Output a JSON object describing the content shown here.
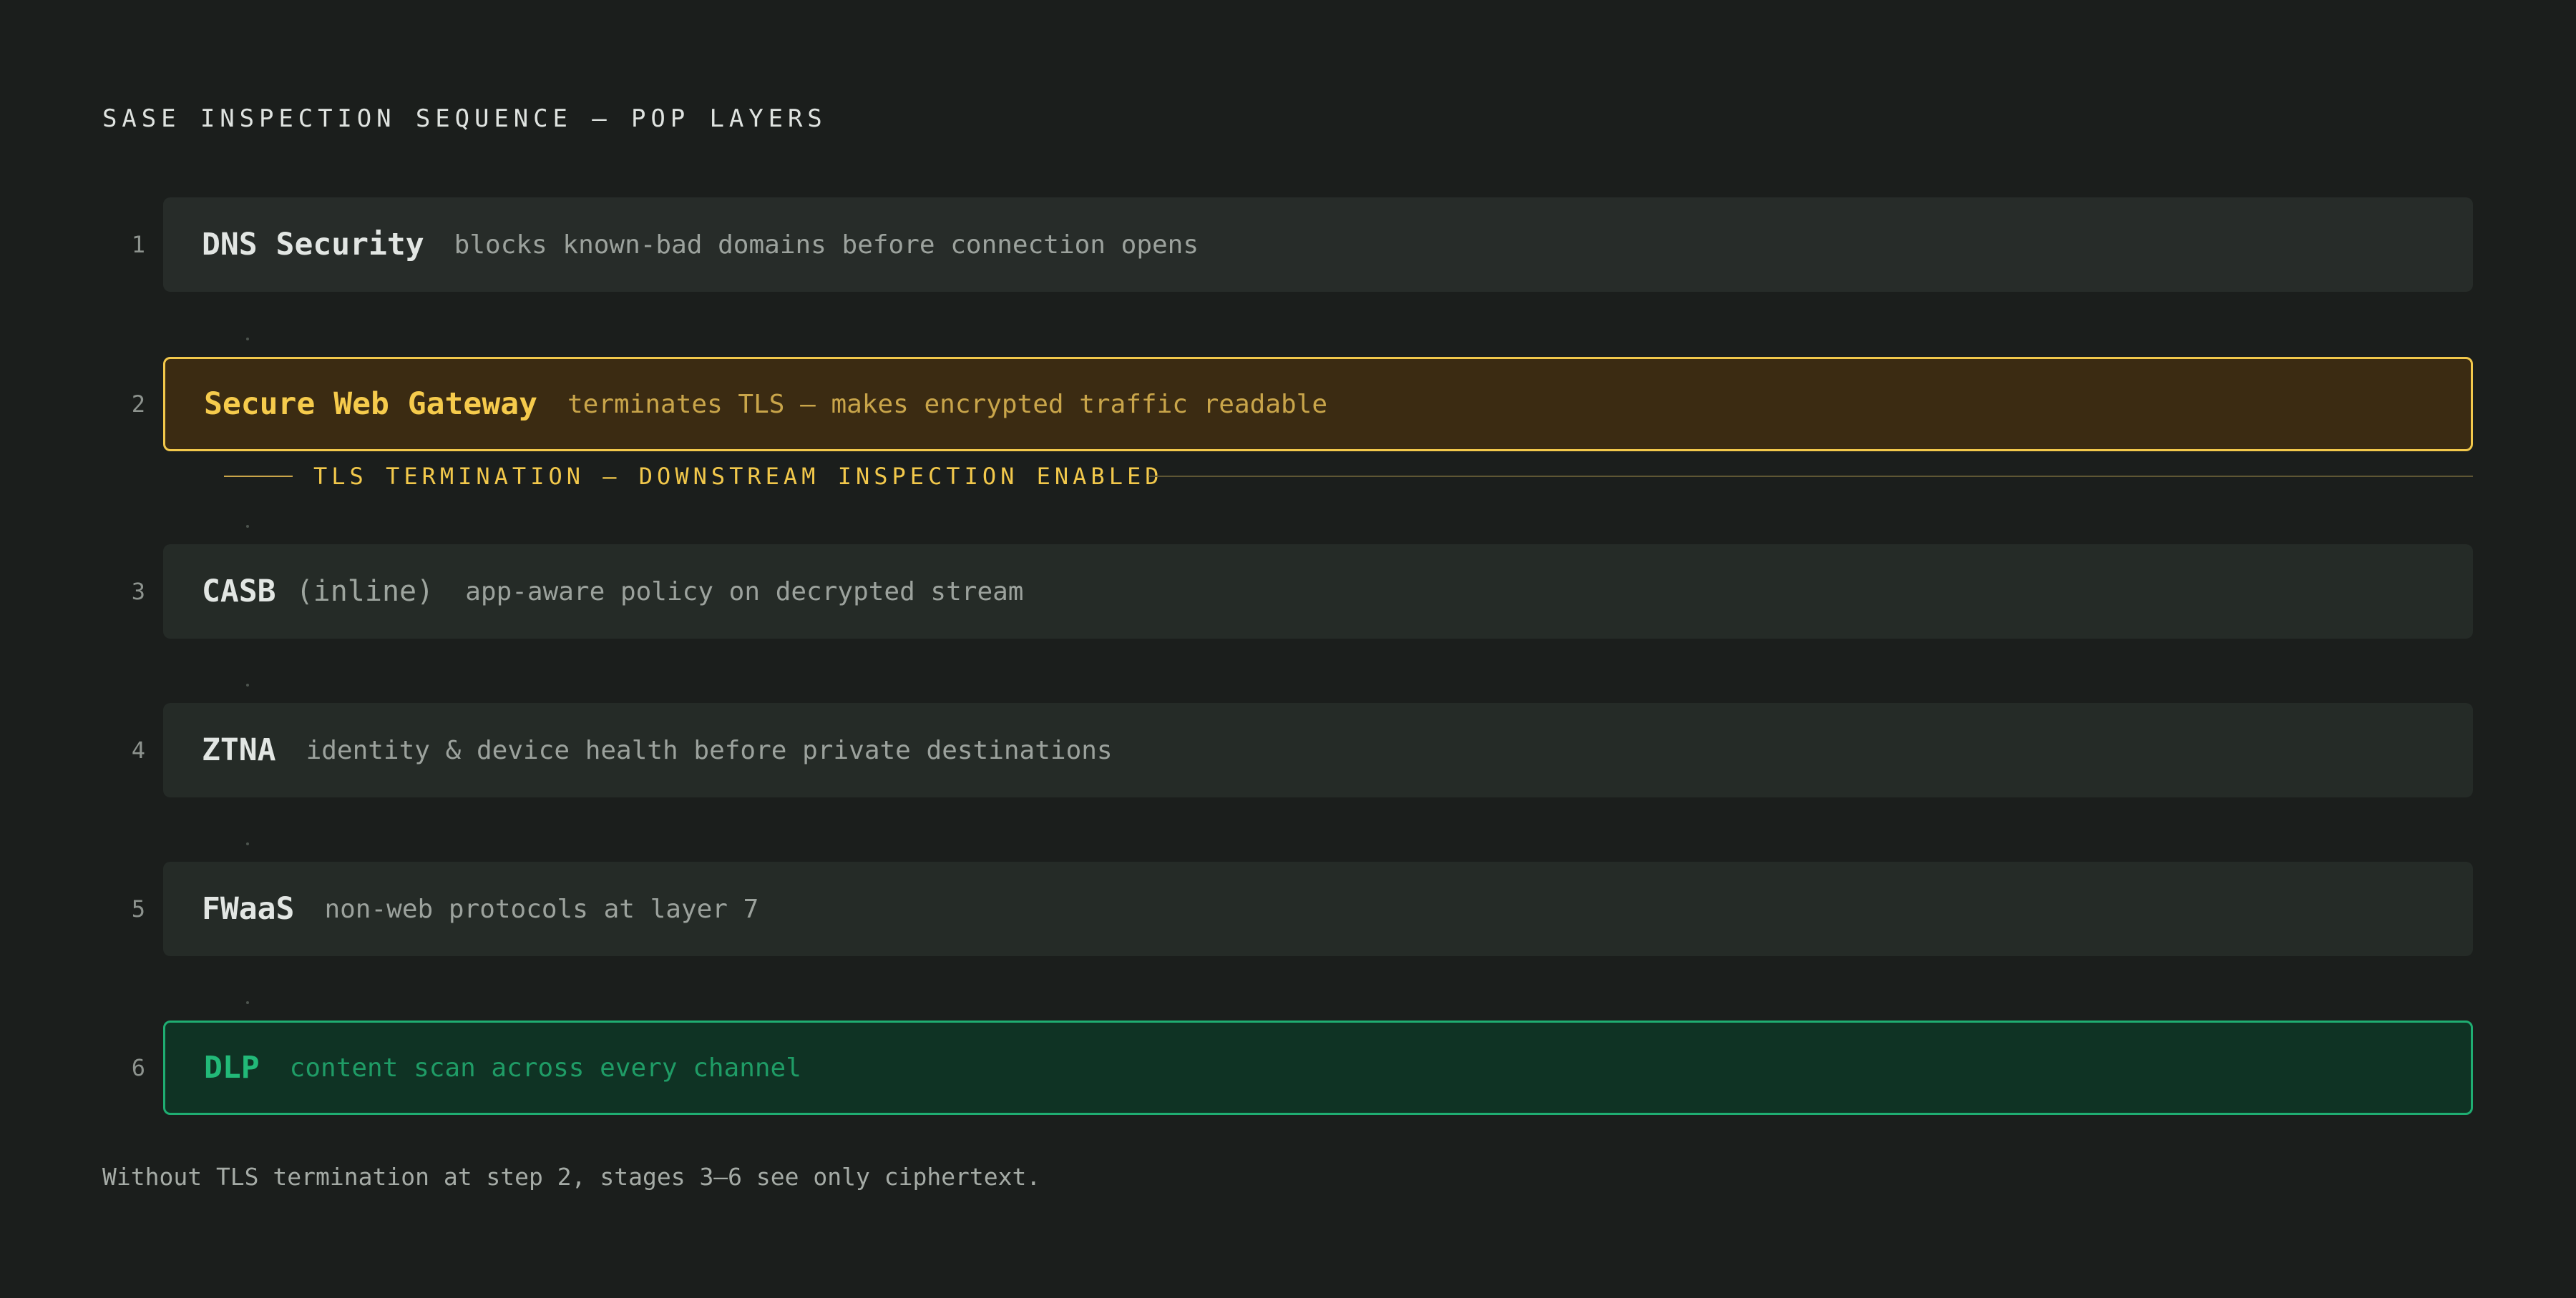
{
  "title": "SASE INSPECTION SEQUENCE — POP LAYERS",
  "steps": [
    {
      "number": "1",
      "name": "DNS Security",
      "tag": "",
      "description": "blocks known-bad domains before connection opens"
    },
    {
      "number": "2",
      "name": "Secure Web Gateway",
      "tag": "",
      "description": "terminates TLS — makes encrypted traffic readable"
    },
    {
      "number": "3",
      "name": "CASB",
      "tag": "(inline)",
      "description": "app-aware policy on decrypted stream"
    },
    {
      "number": "4",
      "name": "ZTNA",
      "tag": "",
      "description": "identity & device health before private destinations"
    },
    {
      "number": "5",
      "name": "FWaaS",
      "tag": "",
      "description": "non-web protocols at layer 7"
    },
    {
      "number": "6",
      "name": "DLP",
      "tag": "",
      "description": "content scan across every channel"
    }
  ],
  "tls_banner": "TLS TERMINATION — DOWNSTREAM INSPECTION ENABLED",
  "footnote": "Without TLS termination at step 2, stages 3–6 see only ciphertext.",
  "colors": {
    "background": "#1b1e1c",
    "card": "#252b27",
    "amber_accent": "#f2c84b",
    "green_accent": "#1fae72"
  }
}
